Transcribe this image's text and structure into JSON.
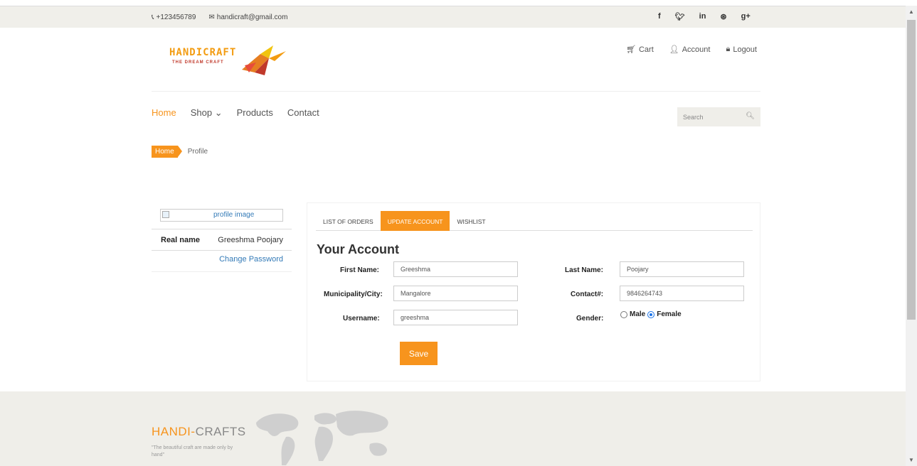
{
  "topbar": {
    "phone": "+123456789",
    "email": "handicraft@gmail.com",
    "social": [
      "f",
      "y",
      "in",
      "⊛",
      "g+"
    ]
  },
  "logo": {
    "word": "HANDICRAFT",
    "tagline": "THE DREAM CRAFT"
  },
  "header_links": {
    "cart": "Cart",
    "account": "Account",
    "logout": "Logout"
  },
  "nav": {
    "home": "Home",
    "shop": "Shop",
    "products": "Products",
    "contact": "Contact"
  },
  "search": {
    "placeholder": "Search"
  },
  "breadcrumb": {
    "home": "Home",
    "current": "Profile"
  },
  "sidebar": {
    "image_alt": "profile image",
    "real_name_label": "Real name",
    "real_name_value": "Greeshma Poojary",
    "change_password": "Change Password"
  },
  "tabs": [
    "LIST OF ORDERS",
    "UPDATE ACCOUNT",
    "WISHLIST"
  ],
  "form": {
    "title": "Your Account",
    "first_name_label": "First Name:",
    "first_name": "Greeshma",
    "last_name_label": "Last Name:",
    "last_name": "Poojary",
    "city_label": "Municipality/City:",
    "city": "Mangalore",
    "contact_label": "Contact#:",
    "contact": "9846264743",
    "username_label": "Username:",
    "username": "greeshma",
    "gender_label": "Gender:",
    "male": "Male",
    "female": "Female",
    "gender_selected": "Female",
    "save": "Save"
  },
  "footer": {
    "brand_a": "HANDI-",
    "brand_b": "CRAFTS",
    "slogan": "\"The beautiful craft are made only by hand\""
  },
  "colors": {
    "accent": "#f7941d",
    "link": "#337ab7",
    "bar": "#f0efea"
  }
}
